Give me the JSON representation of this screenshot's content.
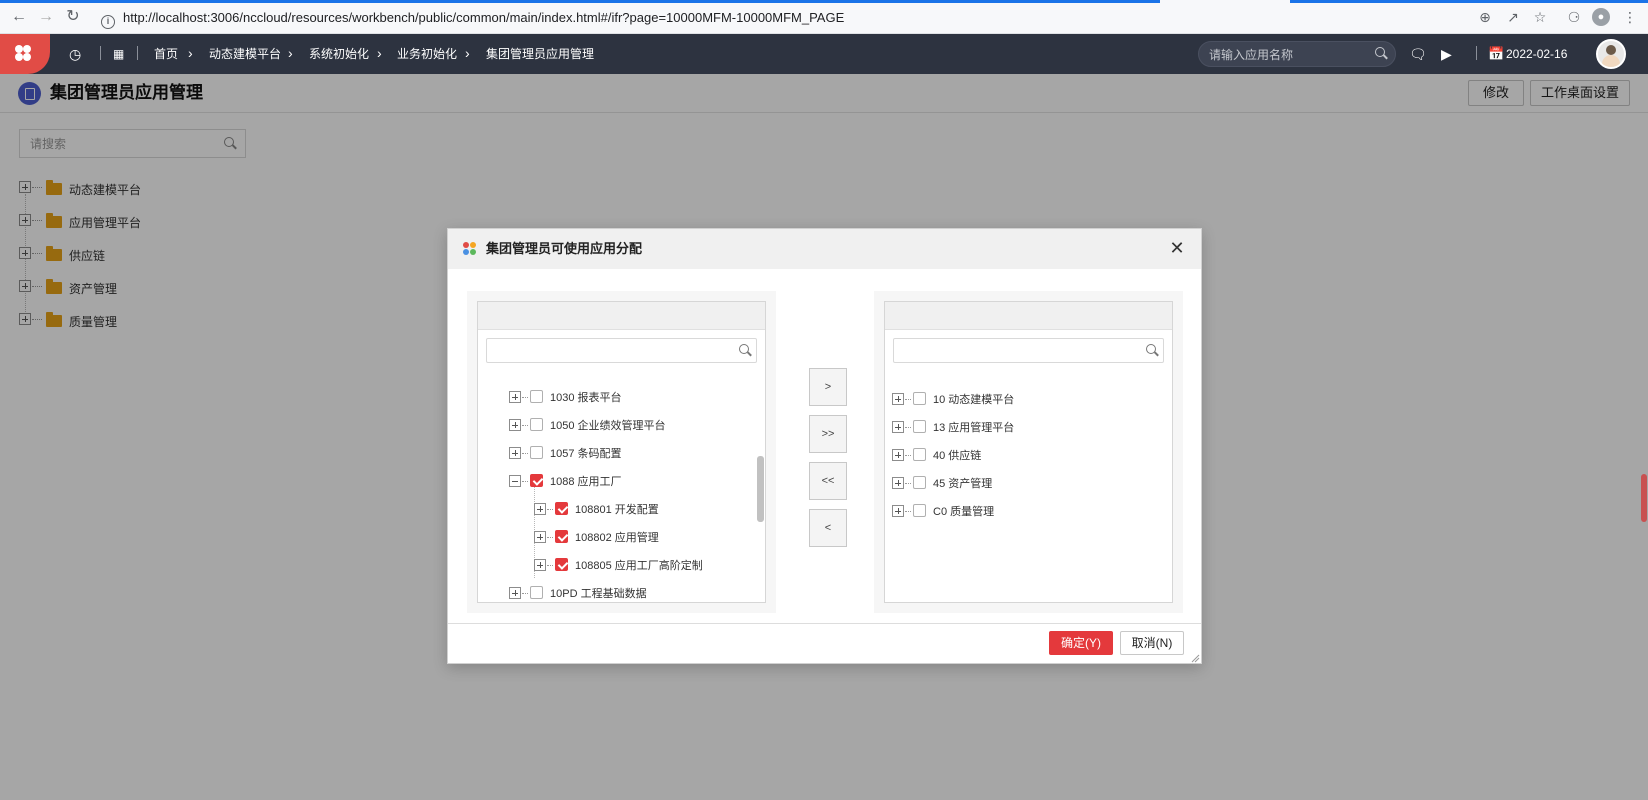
{
  "browser": {
    "url": "http://localhost:3006/nccloud/resources/workbench/public/common/main/index.html#/ifr?page=10000MFM-10000MFM_PAGE",
    "icons": [
      "back-arrow-icon",
      "forward-arrow-icon",
      "reload-icon",
      "info-icon",
      "zoom-icon",
      "share-icon",
      "star-icon",
      "extensions-icon",
      "profile-icon",
      "more-icon"
    ]
  },
  "header": {
    "breadcrumbs": [
      "首页",
      "动态建模平台",
      "系统初始化",
      "业务初始化",
      "集团管理员应用管理"
    ],
    "search_placeholder": "请输入应用名称",
    "date": "2022-02-16",
    "accent": "#e14c46",
    "background": "#2d3340"
  },
  "page": {
    "title": "集团管理员应用管理",
    "edit_label": "修改",
    "desktop_settings_label": "工作桌面设置",
    "search_placeholder": "请搜索",
    "tree": [
      {
        "label": "动态建模平台"
      },
      {
        "label": "应用管理平台"
      },
      {
        "label": "供应链"
      },
      {
        "label": "资产管理"
      },
      {
        "label": "质量管理"
      }
    ]
  },
  "modal": {
    "title": "集团管理员可使用应用分配",
    "close_label": "✕",
    "left_nodes": [
      {
        "label": "1030 报表平台",
        "checked": false,
        "expanded": false
      },
      {
        "label": "1050 企业绩效管理平台",
        "checked": false,
        "expanded": false
      },
      {
        "label": "1057 条码配置",
        "checked": false,
        "expanded": false
      },
      {
        "label": "1088 应用工厂",
        "checked": true,
        "expanded": true
      },
      {
        "label": "108801 开发配置",
        "checked": true,
        "expanded": false
      },
      {
        "label": "108802 应用管理",
        "checked": true,
        "expanded": false
      },
      {
        "label": "108805 应用工厂高阶定制",
        "checked": true,
        "expanded": false
      },
      {
        "label": "10PD 工程基础数据",
        "checked": false,
        "expanded": false
      }
    ],
    "right_nodes": [
      {
        "label": "10 动态建模平台",
        "checked": false
      },
      {
        "label": "13 应用管理平台",
        "checked": false
      },
      {
        "label": "40 供应链",
        "checked": false
      },
      {
        "label": "45 资产管理",
        "checked": false
      },
      {
        "label": "C0 质量管理",
        "checked": false
      }
    ],
    "transfer_buttons": [
      ">",
      ">>",
      "<<",
      "<"
    ],
    "ok_label": "确定(Y)",
    "cancel_label": "取消(N)",
    "accent": "#e4393c"
  }
}
